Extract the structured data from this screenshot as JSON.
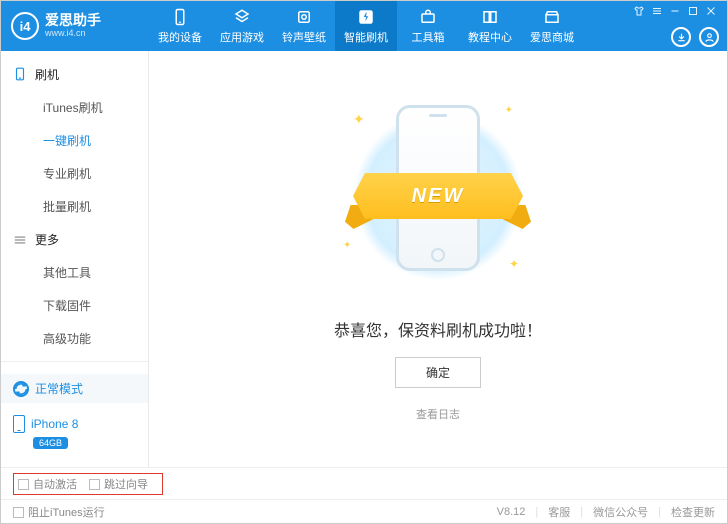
{
  "brand": {
    "logo_letter": "i4",
    "title": "爱思助手",
    "url": "www.i4.cn"
  },
  "nav": {
    "items": [
      {
        "label": "我的设备"
      },
      {
        "label": "应用游戏"
      },
      {
        "label": "铃声壁纸"
      },
      {
        "label": "智能刷机"
      },
      {
        "label": "工具箱"
      },
      {
        "label": "教程中心"
      },
      {
        "label": "爱思商城"
      }
    ],
    "active_index": 3
  },
  "sidebar": {
    "groups": [
      {
        "title": "刷机",
        "items": [
          "iTunes刷机",
          "一键刷机",
          "专业刷机",
          "批量刷机"
        ],
        "active_index": 1
      },
      {
        "title": "更多",
        "items": [
          "其他工具",
          "下载固件",
          "高级功能"
        ]
      }
    ],
    "mode": "正常模式",
    "device": {
      "name": "iPhone 8",
      "storage": "64GB"
    }
  },
  "main": {
    "ribbon_text": "NEW",
    "success_text": "恭喜您，保资料刷机成功啦！",
    "ok_button": "确定",
    "view_log": "查看日志"
  },
  "bottom": {
    "auto_activate": "自动激活",
    "skip_guide": "跳过向导",
    "block_itunes": "阻止iTunes运行",
    "version": "V8.12",
    "support": "客服",
    "wechat": "微信公众号",
    "check_update": "检查更新"
  }
}
